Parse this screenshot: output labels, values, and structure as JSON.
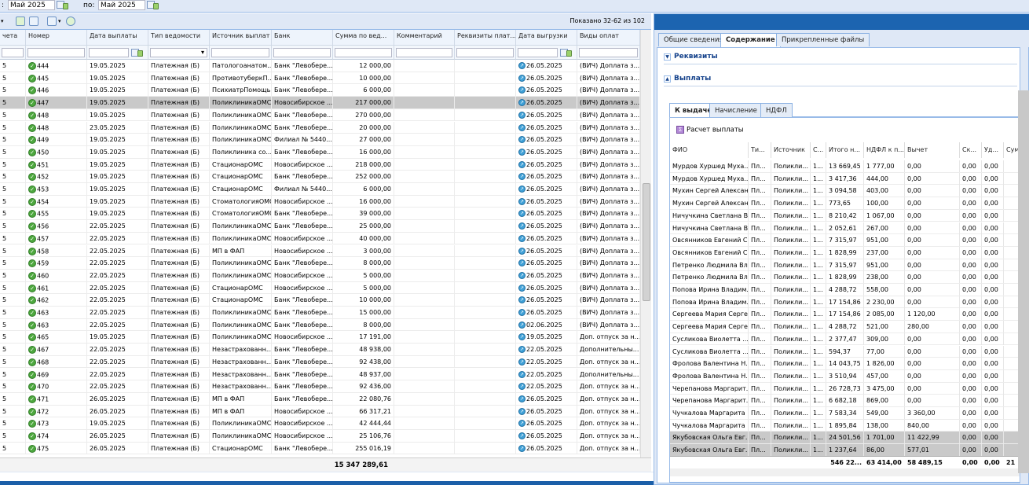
{
  "filter": {
    "from_label": ":",
    "from_value": "Май 2025",
    "to_label": "по:",
    "to_value": "Май 2025"
  },
  "grid": {
    "shown_text": "Показано 32-62 из 102",
    "columns": [
      "чета",
      "Номер",
      "Дата выплаты",
      "Тип ведомости",
      "Источник выплат",
      "Банк",
      "Сумма по вед...",
      "Комментарий",
      "Реквизиты плат...",
      "Дата выгрузки",
      "Виды оплат"
    ],
    "rows": [
      [
        "5",
        "444",
        "19.05.2025",
        "Платежная (Б)",
        "Патологоанатом...",
        "Банк \"Левобере...",
        "12 000,00",
        "",
        "",
        "26.05.2025",
        "(ВИЧ) Доплата з..."
      ],
      [
        "5",
        "445",
        "19.05.2025",
        "Платежная (Б)",
        "ПротивотуберкП...",
        "Банк \"Левобере...",
        "10 000,00",
        "",
        "",
        "26.05.2025",
        "(ВИЧ) Доплата з..."
      ],
      [
        "5",
        "446",
        "19.05.2025",
        "Платежная (Б)",
        "ПсихиатрПомощь",
        "Банк \"Левобере...",
        "6 000,00",
        "",
        "",
        "26.05.2025",
        "(ВИЧ) Доплата з..."
      ],
      [
        "5",
        "447",
        "19.05.2025",
        "Платежная (Б)",
        "ПоликлиникаОМС",
        "Новосибирское ...",
        "217 000,00",
        "",
        "",
        "26.05.2025",
        "(ВИЧ) Доплата з..."
      ],
      [
        "5",
        "448",
        "19.05.2025",
        "Платежная (Б)",
        "ПоликлиникаОМС",
        "Банк \"Левобере...",
        "270 000,00",
        "",
        "",
        "26.05.2025",
        "(ВИЧ) Доплата з..."
      ],
      [
        "5",
        "448",
        "23.05.2025",
        "Платежная (Б)",
        "ПоликлиникаОМС",
        "Банк \"Левобере...",
        "20 000,00",
        "",
        "",
        "26.05.2025",
        "(ВИЧ) Доплата з..."
      ],
      [
        "5",
        "449",
        "19.05.2025",
        "Платежная (Б)",
        "ПоликлиникаОМС",
        "Филиал № 5440...",
        "27 000,00",
        "",
        "",
        "26.05.2025",
        "(ВИЧ) Доплата з..."
      ],
      [
        "5",
        "450",
        "19.05.2025",
        "Платежная (Б)",
        "Поликлиника со...",
        "Банк \"Левобере...",
        "16 000,00",
        "",
        "",
        "26.05.2025",
        "(ВИЧ) Доплата з..."
      ],
      [
        "5",
        "451",
        "19.05.2025",
        "Платежная (Б)",
        "СтационарОМС",
        "Новосибирское ...",
        "218 000,00",
        "",
        "",
        "26.05.2025",
        "(ВИЧ) Доплата з..."
      ],
      [
        "5",
        "452",
        "19.05.2025",
        "Платежная (Б)",
        "СтационарОМС",
        "Банк \"Левобере...",
        "252 000,00",
        "",
        "",
        "26.05.2025",
        "(ВИЧ) Доплата з..."
      ],
      [
        "5",
        "453",
        "19.05.2025",
        "Платежная (Б)",
        "СтационарОМС",
        "Филиал № 5440...",
        "6 000,00",
        "",
        "",
        "26.05.2025",
        "(ВИЧ) Доплата з..."
      ],
      [
        "5",
        "454",
        "19.05.2025",
        "Платежная (Б)",
        "СтоматологияОМС",
        "Новосибирское ...",
        "16 000,00",
        "",
        "",
        "26.05.2025",
        "(ВИЧ) Доплата з..."
      ],
      [
        "5",
        "455",
        "19.05.2025",
        "Платежная (Б)",
        "СтоматологияОМС",
        "Банк \"Левобере...",
        "39 000,00",
        "",
        "",
        "26.05.2025",
        "(ВИЧ) Доплата з..."
      ],
      [
        "5",
        "456",
        "22.05.2025",
        "Платежная (Б)",
        "ПоликлиникаОМС",
        "Банк \"Левобере...",
        "25 000,00",
        "",
        "",
        "26.05.2025",
        "(ВИЧ) Доплата з..."
      ],
      [
        "5",
        "457",
        "22.05.2025",
        "Платежная (Б)",
        "ПоликлиникаОМС",
        "Новосибирское ...",
        "40 000,00",
        "",
        "",
        "26.05.2025",
        "(ВИЧ) Доплата з..."
      ],
      [
        "5",
        "458",
        "22.05.2025",
        "Платежная (Б)",
        "МП в ФАП",
        "Новосибирское ...",
        "3 000,00",
        "",
        "",
        "26.05.2025",
        "(ВИЧ) Доплата з..."
      ],
      [
        "5",
        "459",
        "22.05.2025",
        "Платежная (Б)",
        "ПоликлиникаОМС",
        "Банк \"Левобере...",
        "8 000,00",
        "",
        "",
        "26.05.2025",
        "(ВИЧ) Доплата з..."
      ],
      [
        "5",
        "460",
        "22.05.2025",
        "Платежная (Б)",
        "ПоликлиникаОМС",
        "Новосибирское ...",
        "5 000,00",
        "",
        "",
        "26.05.2025",
        "(ВИЧ) Доплата з..."
      ],
      [
        "5",
        "461",
        "22.05.2025",
        "Платежная (Б)",
        "СтационарОМС",
        "Новосибирское ...",
        "5 000,00",
        "",
        "",
        "26.05.2025",
        "(ВИЧ) Доплата з..."
      ],
      [
        "5",
        "462",
        "22.05.2025",
        "Платежная (Б)",
        "СтационарОМС",
        "Банк \"Левобере...",
        "10 000,00",
        "",
        "",
        "26.05.2025",
        "(ВИЧ) Доплата з..."
      ],
      [
        "5",
        "463",
        "22.05.2025",
        "Платежная (Б)",
        "ПоликлиникаОМС",
        "Банк \"Левобере...",
        "15 000,00",
        "",
        "",
        "26.05.2025",
        "(ВИЧ) Доплата з..."
      ],
      [
        "5",
        "463",
        "22.05.2025",
        "Платежная (Б)",
        "ПоликлиникаОМС",
        "Банк \"Левобере...",
        "8 000,00",
        "",
        "",
        "02.06.2025",
        "(ВИЧ) Доплата з..."
      ],
      [
        "5",
        "465",
        "19.05.2025",
        "Платежная (Б)",
        "ПоликлиникаОМС",
        "Новосибирское ...",
        "17 191,00",
        "",
        "",
        "19.05.2025",
        "Доп. отпуск за н..."
      ],
      [
        "5",
        "467",
        "22.05.2025",
        "Платежная (Б)",
        "Незастрахованн...",
        "Банк \"Левобере...",
        "48 938,00",
        "",
        "",
        "22.05.2025",
        "Дополнительны..."
      ],
      [
        "5",
        "468",
        "22.05.2025",
        "Платежная (Б)",
        "Незастрахованн...",
        "Банк \"Левобере...",
        "92 438,00",
        "",
        "",
        "22.05.2025",
        "Доп. отпуск за н..."
      ],
      [
        "5",
        "469",
        "22.05.2025",
        "Платежная (Б)",
        "Незастрахованн...",
        "Банк \"Левобере...",
        "48 937,00",
        "",
        "",
        "22.05.2025",
        "Дополнительны..."
      ],
      [
        "5",
        "470",
        "22.05.2025",
        "Платежная (Б)",
        "Незастрахованн...",
        "Банк \"Левобере...",
        "92 436,00",
        "",
        "",
        "22.05.2025",
        "Доп. отпуск за н..."
      ],
      [
        "5",
        "471",
        "26.05.2025",
        "Платежная (Б)",
        "МП в ФАП",
        "Банк \"Левобере...",
        "22 080,76",
        "",
        "",
        "26.05.2025",
        "Доп. отпуск за н..."
      ],
      [
        "5",
        "472",
        "26.05.2025",
        "Платежная (Б)",
        "МП в ФАП",
        "Новосибирское ...",
        "66 317,21",
        "",
        "",
        "26.05.2025",
        "Доп. отпуск за н..."
      ],
      [
        "5",
        "473",
        "19.05.2025",
        "Платежная (Б)",
        "ПоликлиникаОМС",
        "Новосибирское ...",
        "42 444,44",
        "",
        "",
        "26.05.2025",
        "Доп. отпуск за н..."
      ],
      [
        "5",
        "474",
        "26.05.2025",
        "Платежная (Б)",
        "ПоликлиникаОМС",
        "Новосибирское ...",
        "25 106,76",
        "",
        "",
        "26.05.2025",
        "Доп. отпуск за н..."
      ],
      [
        "5",
        "475",
        "26.05.2025",
        "Платежная (Б)",
        "СтационарОМС",
        "Банк \"Левобере...",
        "255 016,19",
        "",
        "",
        "26.05.2025",
        "Доп. отпуск за н..."
      ]
    ],
    "total": "15 347 289,61"
  },
  "right": {
    "tabs": [
      "Общие сведения",
      "Содержание",
      "Прикрепленные файлы"
    ],
    "section_requisites": "Реквизиты",
    "section_payments": "Выплаты",
    "subtabs": [
      "К выдаче",
      "Начисление",
      "НДФЛ"
    ],
    "calc_button": "Расчет выплаты",
    "columns": [
      "ФИО",
      "Ти...",
      "Источник",
      "С...",
      "Итого н...",
      "НДФЛ к п...",
      "Вычет",
      "Ск...",
      "Уд...",
      "Сум"
    ],
    "rows": [
      [
        "Мурдов Хуршед Муха...",
        "Пл...",
        "Поликли...",
        "1...",
        "13 669,45",
        "1 777,00",
        "0,00",
        "0,00",
        "0,00"
      ],
      [
        "Мурдов Хуршед Муха...",
        "Пл...",
        "Поликли...",
        "1...",
        "3 417,36",
        "444,00",
        "0,00",
        "0,00",
        "0,00"
      ],
      [
        "Мухин Сергей Алексан...",
        "Пл...",
        "Поликли...",
        "1...",
        "3 094,58",
        "403,00",
        "0,00",
        "0,00",
        "0,00"
      ],
      [
        "Мухин Сергей Алексан...",
        "Пл...",
        "Поликли...",
        "1...",
        "773,65",
        "100,00",
        "0,00",
        "0,00",
        "0,00"
      ],
      [
        "Ничучкина Светлана В...",
        "Пл...",
        "Поликли...",
        "1...",
        "8 210,42",
        "1 067,00",
        "0,00",
        "0,00",
        "0,00"
      ],
      [
        "Ничучкина Светлана В...",
        "Пл...",
        "Поликли...",
        "1...",
        "2 052,61",
        "267,00",
        "0,00",
        "0,00",
        "0,00"
      ],
      [
        "Овсянников Евгений С...",
        "Пл...",
        "Поликли...",
        "1...",
        "7 315,97",
        "951,00",
        "0,00",
        "0,00",
        "0,00"
      ],
      [
        "Овсянников Евгений С...",
        "Пл...",
        "Поликли...",
        "1...",
        "1 828,99",
        "237,00",
        "0,00",
        "0,00",
        "0,00"
      ],
      [
        "Петренко Людмила Вл...",
        "Пл...",
        "Поликли...",
        "1...",
        "7 315,97",
        "951,00",
        "0,00",
        "0,00",
        "0,00"
      ],
      [
        "Петренко Людмила Вл...",
        "Пл...",
        "Поликли...",
        "1...",
        "1 828,99",
        "238,00",
        "0,00",
        "0,00",
        "0,00"
      ],
      [
        "Попова Ирина Владим...",
        "Пл...",
        "Поликли...",
        "1...",
        "4 288,72",
        "558,00",
        "0,00",
        "0,00",
        "0,00"
      ],
      [
        "Попова Ирина Владим...",
        "Пл...",
        "Поликли...",
        "1...",
        "17 154,86",
        "2 230,00",
        "0,00",
        "0,00",
        "0,00"
      ],
      [
        "Сергеева Мария Серге...",
        "Пл...",
        "Поликли...",
        "1...",
        "17 154,86",
        "2 085,00",
        "1 120,00",
        "0,00",
        "0,00"
      ],
      [
        "Сергеева Мария Серге...",
        "Пл...",
        "Поликли...",
        "1...",
        "4 288,72",
        "521,00",
        "280,00",
        "0,00",
        "0,00"
      ],
      [
        "Сусликова Виолетта ...",
        "Пл...",
        "Поликли...",
        "1...",
        "2 377,47",
        "309,00",
        "0,00",
        "0,00",
        "0,00"
      ],
      [
        "Сусликова Виолетта ...",
        "Пл...",
        "Поликли...",
        "1...",
        "594,37",
        "77,00",
        "0,00",
        "0,00",
        "0,00"
      ],
      [
        "Фролова Валентина Н...",
        "Пл...",
        "Поликли...",
        "1...",
        "14 043,75",
        "1 826,00",
        "0,00",
        "0,00",
        "0,00"
      ],
      [
        "Фролова Валентина Н...",
        "Пл...",
        "Поликли...",
        "1...",
        "3 510,94",
        "457,00",
        "0,00",
        "0,00",
        "0,00"
      ],
      [
        "Черепанова Маргарит...",
        "Пл...",
        "Поликли...",
        "1...",
        "26 728,73",
        "3 475,00",
        "0,00",
        "0,00",
        "0,00"
      ],
      [
        "Черепанова Маргарит...",
        "Пл...",
        "Поликли...",
        "1...",
        "6 682,18",
        "869,00",
        "0,00",
        "0,00",
        "0,00"
      ],
      [
        "Чучкалова Маргарита ...",
        "Пл...",
        "Поликли...",
        "1...",
        "7 583,34",
        "549,00",
        "3 360,00",
        "0,00",
        "0,00"
      ],
      [
        "Чучкалова Маргарита ...",
        "Пл...",
        "Поликли...",
        "1...",
        "1 895,84",
        "138,00",
        "840,00",
        "0,00",
        "0,00"
      ],
      [
        "Якубовская Ольга Евг...",
        "Пл...",
        "Поликли...",
        "1...",
        "24 501,56",
        "1 701,00",
        "11 422,99",
        "0,00",
        "0,00"
      ],
      [
        "Якубовская Ольга Евг...",
        "Пл...",
        "Поликли...",
        "1...",
        "1 237,64",
        "86,00",
        "577,01",
        "0,00",
        "0,00"
      ]
    ],
    "totals": [
      "546 22...",
      "63 414,00",
      "58 489,15",
      "0,00",
      "0,00",
      "21"
    ]
  }
}
